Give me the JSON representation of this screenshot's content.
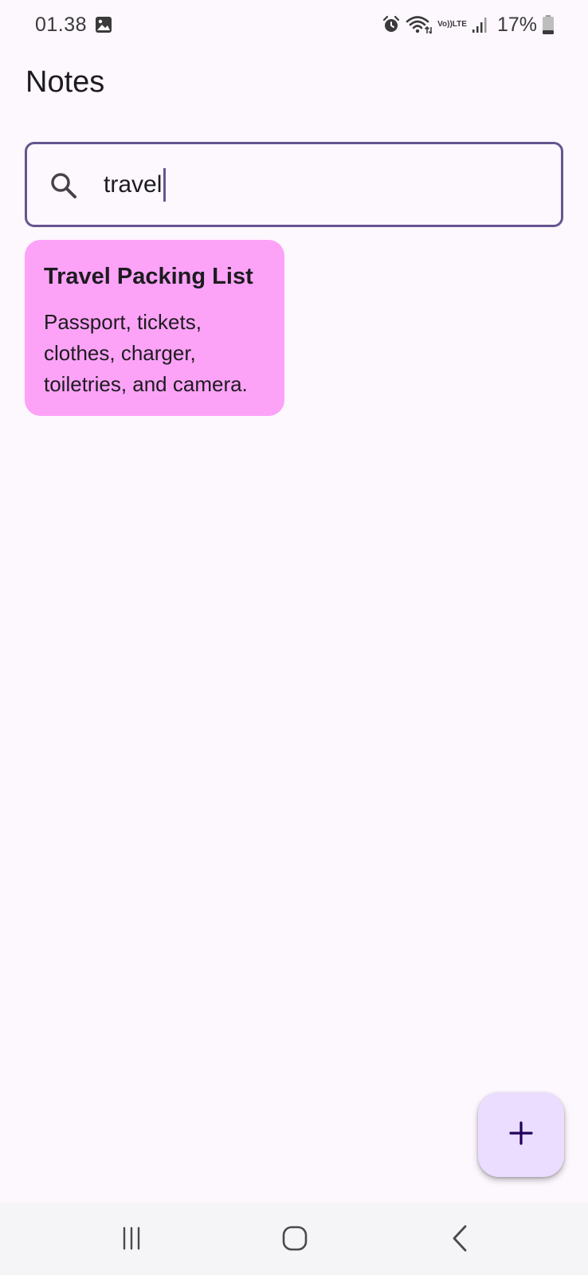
{
  "status_bar": {
    "time": "01.38",
    "gallery_icon": "image-icon",
    "alarm_icon": "alarm-icon",
    "wifi_icon": "wifi-icon",
    "volte_top": "Vo))",
    "volte_bottom": "LTE",
    "signal_icon": "signal-icon",
    "battery_percent": "17%",
    "battery_icon": "battery-icon"
  },
  "header": {
    "title": "Notes"
  },
  "search": {
    "icon": "search-icon",
    "value": "travel"
  },
  "notes": [
    {
      "title": "Travel Packing List",
      "body": "Passport, tickets, clothes, charger, toiletries, and camera.",
      "color": "#fca3f7"
    }
  ],
  "fab": {
    "icon": "plus-icon",
    "color": "#eaddff"
  },
  "nav_bar": {
    "recents_icon": "recents-icon",
    "home_icon": "home-icon",
    "back_icon": "back-icon"
  },
  "colors": {
    "background": "#fdf7fe",
    "accent": "#65558f"
  }
}
